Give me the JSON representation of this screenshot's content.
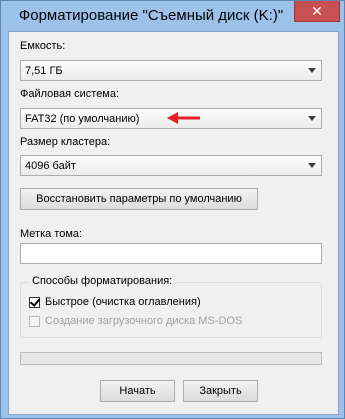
{
  "window": {
    "title": "Форматирование \"Съемный диск (K:)\"",
    "close_label": "✕"
  },
  "capacity": {
    "label": "Емкость:",
    "value": "7,51 ГБ"
  },
  "file_system": {
    "label": "Файловая система:",
    "value": "FAT32 (по умолчанию)"
  },
  "cluster_size": {
    "label": "Размер кластера:",
    "value": "4096 байт"
  },
  "restore_defaults_label": "Восстановить параметры по умолчанию",
  "volume_label": {
    "label": "Метка тома:",
    "value": ""
  },
  "format_options": {
    "title": "Способы форматирования:",
    "quick": {
      "label": "Быстрое (очистка оглавления)",
      "checked": true
    },
    "msdos": {
      "label": "Создание загрузочного диска MS-DOS",
      "checked": false,
      "enabled": false
    }
  },
  "progress": {
    "value": 0
  },
  "buttons": {
    "start": "Начать",
    "close": "Закрыть"
  },
  "colors": {
    "annotation_arrow": "#e3202a"
  }
}
